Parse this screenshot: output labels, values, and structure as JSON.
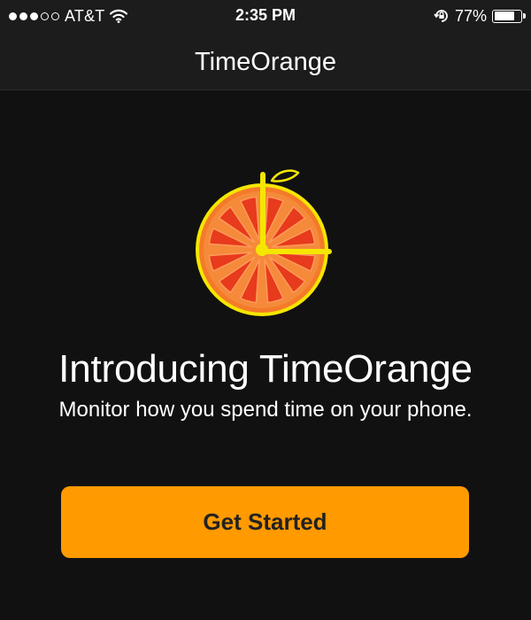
{
  "status_bar": {
    "signal_bars_filled": 3,
    "signal_bars_total": 5,
    "carrier": "AT&T",
    "time": "2:35 PM",
    "battery_percent": "77%",
    "battery_level": 0.77,
    "icons": [
      "signal-dots-icon",
      "wifi-icon",
      "orientation-lock-icon",
      "battery-icon"
    ]
  },
  "nav": {
    "title": "TimeOrange"
  },
  "main": {
    "logo_icon": "orange-clock-logo-icon",
    "headline": "Introducing TimeOrange",
    "subline": "Monitor how you spend time on your phone.",
    "cta_label": "Get Started"
  },
  "colors": {
    "background": "#111111",
    "bar": "#1c1c1c",
    "accent": "#ff9a00",
    "logo_yellow": "#f5e600",
    "logo_red": "#e83a1c",
    "logo_orange": "#f47a2a"
  }
}
